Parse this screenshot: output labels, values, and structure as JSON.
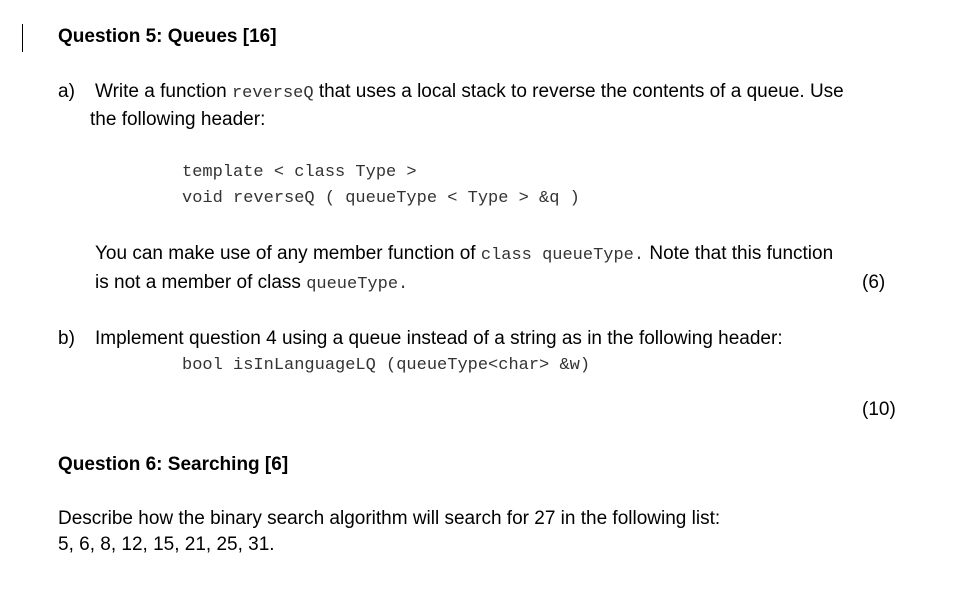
{
  "question5": {
    "title": "Question 5: Queues [16]",
    "part_a": {
      "label": "a)",
      "line1_pre": "Write a function ",
      "line1_code": "reverseQ",
      "line1_post": " that uses a local stack to reverse the contents of a queue. Use",
      "line2": "the following header:",
      "code_lines": [
        "template < class Type >",
        "void reverseQ ( queueType < Type > &q )"
      ],
      "note_line1_pre": "You can make use of any member function of ",
      "note_line1_code": "class queueType.",
      "note_line1_post": " Note that this function",
      "note_line2_pre": "is not a member of class ",
      "note_line2_code": "queueType.",
      "marks": "(6)"
    },
    "part_b": {
      "label": "b)",
      "text": "Implement question 4 using a queue instead of a string as in the following header:",
      "code_line": "bool isInLanguageLQ (queueType<char> &w)",
      "marks": "(10)"
    }
  },
  "question6": {
    "title": "Question 6: Searching [6]",
    "text": "Describe how the binary search algorithm will search for 27 in the following list:",
    "list": "5, 6, 8, 12, 15, 21, 25, 31."
  }
}
